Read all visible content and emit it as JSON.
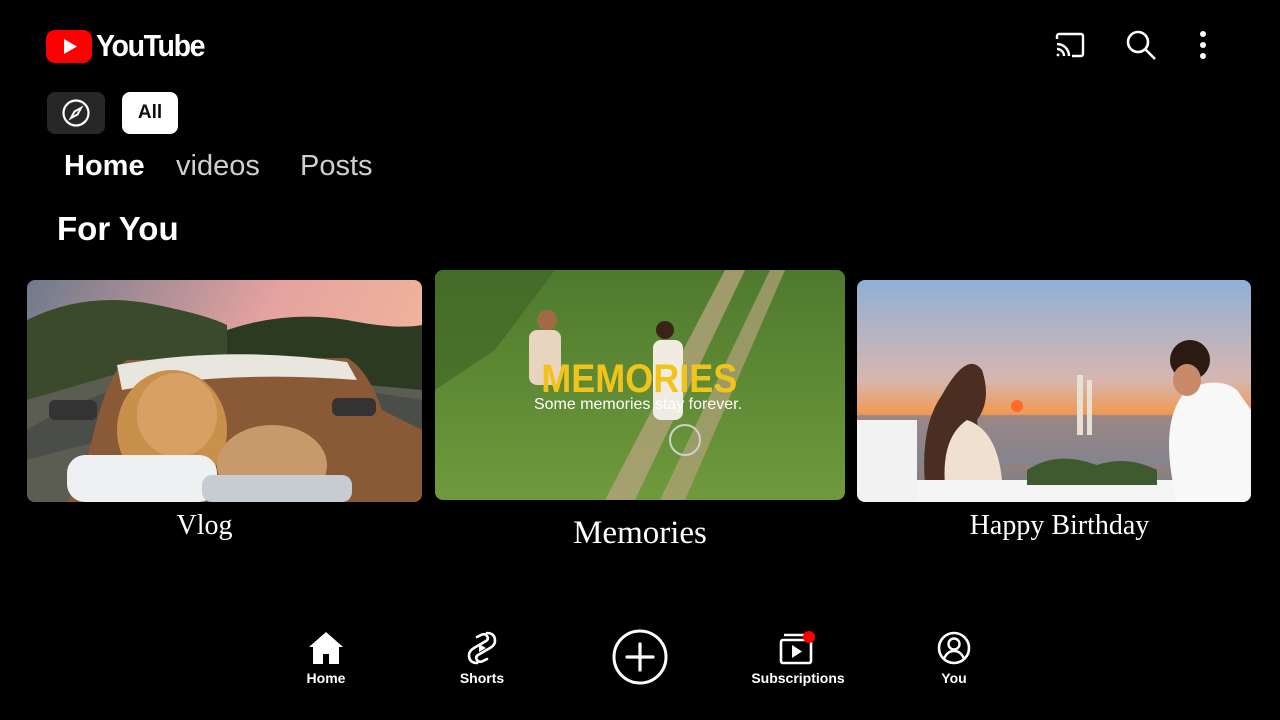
{
  "header": {
    "brand": "YouTube",
    "icons": [
      "cast-icon",
      "search-icon",
      "more-vert-icon"
    ]
  },
  "chips": {
    "explore_icon": "compass-icon",
    "all_label": "All"
  },
  "tabs": [
    {
      "label": "Home",
      "active": true
    },
    {
      "label": "videos",
      "active": false
    },
    {
      "label": "Posts",
      "active": false
    }
  ],
  "section": {
    "title": "For You"
  },
  "cards": [
    {
      "title": "Vlog"
    },
    {
      "title": "Memories",
      "overlay_title": "MEMORIES",
      "overlay_subtitle": "Some memories stay forever."
    },
    {
      "title": "Happy Birthday"
    }
  ],
  "nav": [
    {
      "label": "Home",
      "icon": "home-icon"
    },
    {
      "label": "Shorts",
      "icon": "shorts-icon"
    },
    {
      "label": "",
      "icon": "create-plus-icon"
    },
    {
      "label": "Subscriptions",
      "icon": "subscriptions-icon",
      "badge": true
    },
    {
      "label": "You",
      "icon": "account-icon"
    }
  ],
  "colors": {
    "brand_red": "#ff0000",
    "chip_active_bg": "#ffffff",
    "chip_bg": "#272727",
    "memories_overlay": "#f2c41b",
    "badge": "#ff0000"
  }
}
